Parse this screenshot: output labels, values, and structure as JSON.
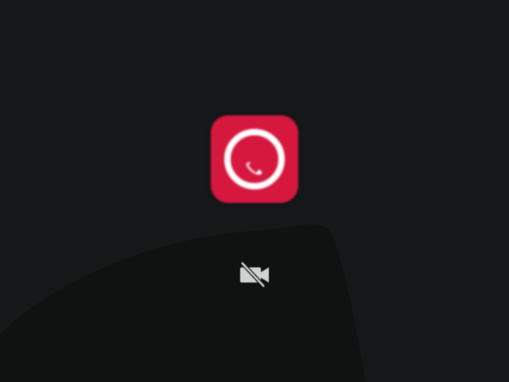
{
  "screen": {
    "background_color": "#141818"
  },
  "app_icon": {
    "icon": "call-app-icon",
    "color": "#d6183f"
  },
  "camera_status": {
    "icon": "camera-off-icon",
    "color": "#cfd2d2"
  }
}
